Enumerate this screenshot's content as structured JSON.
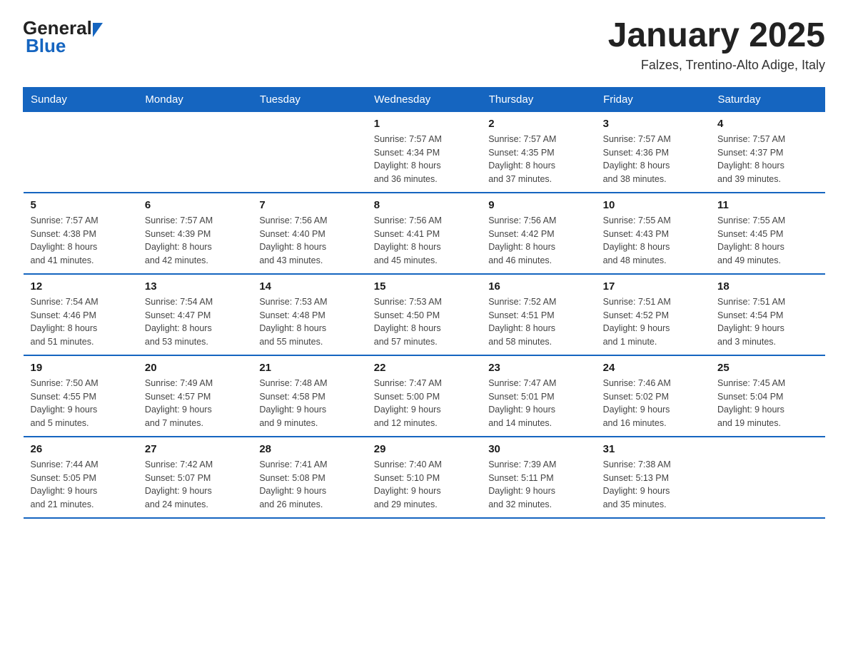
{
  "header": {
    "logo_general": "General",
    "logo_blue": "Blue",
    "title": "January 2025",
    "location": "Falzes, Trentino-Alto Adige, Italy"
  },
  "calendar": {
    "days_of_week": [
      "Sunday",
      "Monday",
      "Tuesday",
      "Wednesday",
      "Thursday",
      "Friday",
      "Saturday"
    ],
    "weeks": [
      [
        {
          "day": "",
          "info": ""
        },
        {
          "day": "",
          "info": ""
        },
        {
          "day": "",
          "info": ""
        },
        {
          "day": "1",
          "info": "Sunrise: 7:57 AM\nSunset: 4:34 PM\nDaylight: 8 hours\nand 36 minutes."
        },
        {
          "day": "2",
          "info": "Sunrise: 7:57 AM\nSunset: 4:35 PM\nDaylight: 8 hours\nand 37 minutes."
        },
        {
          "day": "3",
          "info": "Sunrise: 7:57 AM\nSunset: 4:36 PM\nDaylight: 8 hours\nand 38 minutes."
        },
        {
          "day": "4",
          "info": "Sunrise: 7:57 AM\nSunset: 4:37 PM\nDaylight: 8 hours\nand 39 minutes."
        }
      ],
      [
        {
          "day": "5",
          "info": "Sunrise: 7:57 AM\nSunset: 4:38 PM\nDaylight: 8 hours\nand 41 minutes."
        },
        {
          "day": "6",
          "info": "Sunrise: 7:57 AM\nSunset: 4:39 PM\nDaylight: 8 hours\nand 42 minutes."
        },
        {
          "day": "7",
          "info": "Sunrise: 7:56 AM\nSunset: 4:40 PM\nDaylight: 8 hours\nand 43 minutes."
        },
        {
          "day": "8",
          "info": "Sunrise: 7:56 AM\nSunset: 4:41 PM\nDaylight: 8 hours\nand 45 minutes."
        },
        {
          "day": "9",
          "info": "Sunrise: 7:56 AM\nSunset: 4:42 PM\nDaylight: 8 hours\nand 46 minutes."
        },
        {
          "day": "10",
          "info": "Sunrise: 7:55 AM\nSunset: 4:43 PM\nDaylight: 8 hours\nand 48 minutes."
        },
        {
          "day": "11",
          "info": "Sunrise: 7:55 AM\nSunset: 4:45 PM\nDaylight: 8 hours\nand 49 minutes."
        }
      ],
      [
        {
          "day": "12",
          "info": "Sunrise: 7:54 AM\nSunset: 4:46 PM\nDaylight: 8 hours\nand 51 minutes."
        },
        {
          "day": "13",
          "info": "Sunrise: 7:54 AM\nSunset: 4:47 PM\nDaylight: 8 hours\nand 53 minutes."
        },
        {
          "day": "14",
          "info": "Sunrise: 7:53 AM\nSunset: 4:48 PM\nDaylight: 8 hours\nand 55 minutes."
        },
        {
          "day": "15",
          "info": "Sunrise: 7:53 AM\nSunset: 4:50 PM\nDaylight: 8 hours\nand 57 minutes."
        },
        {
          "day": "16",
          "info": "Sunrise: 7:52 AM\nSunset: 4:51 PM\nDaylight: 8 hours\nand 58 minutes."
        },
        {
          "day": "17",
          "info": "Sunrise: 7:51 AM\nSunset: 4:52 PM\nDaylight: 9 hours\nand 1 minute."
        },
        {
          "day": "18",
          "info": "Sunrise: 7:51 AM\nSunset: 4:54 PM\nDaylight: 9 hours\nand 3 minutes."
        }
      ],
      [
        {
          "day": "19",
          "info": "Sunrise: 7:50 AM\nSunset: 4:55 PM\nDaylight: 9 hours\nand 5 minutes."
        },
        {
          "day": "20",
          "info": "Sunrise: 7:49 AM\nSunset: 4:57 PM\nDaylight: 9 hours\nand 7 minutes."
        },
        {
          "day": "21",
          "info": "Sunrise: 7:48 AM\nSunset: 4:58 PM\nDaylight: 9 hours\nand 9 minutes."
        },
        {
          "day": "22",
          "info": "Sunrise: 7:47 AM\nSunset: 5:00 PM\nDaylight: 9 hours\nand 12 minutes."
        },
        {
          "day": "23",
          "info": "Sunrise: 7:47 AM\nSunset: 5:01 PM\nDaylight: 9 hours\nand 14 minutes."
        },
        {
          "day": "24",
          "info": "Sunrise: 7:46 AM\nSunset: 5:02 PM\nDaylight: 9 hours\nand 16 minutes."
        },
        {
          "day": "25",
          "info": "Sunrise: 7:45 AM\nSunset: 5:04 PM\nDaylight: 9 hours\nand 19 minutes."
        }
      ],
      [
        {
          "day": "26",
          "info": "Sunrise: 7:44 AM\nSunset: 5:05 PM\nDaylight: 9 hours\nand 21 minutes."
        },
        {
          "day": "27",
          "info": "Sunrise: 7:42 AM\nSunset: 5:07 PM\nDaylight: 9 hours\nand 24 minutes."
        },
        {
          "day": "28",
          "info": "Sunrise: 7:41 AM\nSunset: 5:08 PM\nDaylight: 9 hours\nand 26 minutes."
        },
        {
          "day": "29",
          "info": "Sunrise: 7:40 AM\nSunset: 5:10 PM\nDaylight: 9 hours\nand 29 minutes."
        },
        {
          "day": "30",
          "info": "Sunrise: 7:39 AM\nSunset: 5:11 PM\nDaylight: 9 hours\nand 32 minutes."
        },
        {
          "day": "31",
          "info": "Sunrise: 7:38 AM\nSunset: 5:13 PM\nDaylight: 9 hours\nand 35 minutes."
        },
        {
          "day": "",
          "info": ""
        }
      ]
    ]
  }
}
